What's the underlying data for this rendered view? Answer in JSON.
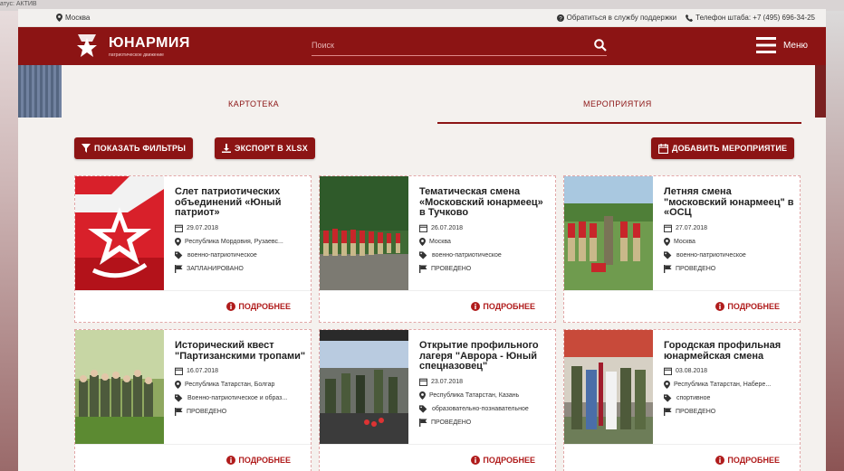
{
  "background": {
    "top_text": "атус: АКТИВ"
  },
  "topbar": {
    "location": "Москва",
    "support": "Обратиться в службу поддержки",
    "phone": "Телефон штаба: +7 (495) 696-34-25"
  },
  "header": {
    "logo_title": "ЮНАРМИЯ",
    "logo_subtitle": "патриотическое движение",
    "search_placeholder": "Поиск",
    "menu_label": "Меню"
  },
  "tabs": [
    {
      "label": "КАРТОТЕКА",
      "active": false
    },
    {
      "label": "МЕРОПРИЯТИЯ",
      "active": true
    }
  ],
  "toolbar": {
    "filters_label": "ПОКАЗАТЬ ФИЛЬТРЫ",
    "export_label": "ЭКСПОРТ В XLSX",
    "add_label": "ДОБАВИТЬ МЕРОПРИЯТИЕ"
  },
  "events": [
    {
      "title": "Слет патриотических объединений «Юный патриот»",
      "date": "29.07.2018",
      "location": "Республика Мордовия, Рузаевс...",
      "category": "военно-патриотическое",
      "status": "ЗАПЛАНИРОВАНО",
      "more": "ПОДРОБНЕЕ"
    },
    {
      "title": "Тематическая смена «Московский юнармеец» в Тучково",
      "date": "26.07.2018",
      "location": "Москва",
      "category": "военно-патриотическое",
      "status": "ПРОВЕДЕНО",
      "more": "ПОДРОБНЕЕ"
    },
    {
      "title": "Летняя смена \"московский юнармеец\" в «ОСЦ",
      "date": "27.07.2018",
      "location": "Москва",
      "category": "военно-патриотическое",
      "status": "ПРОВЕДЕНО",
      "more": "ПОДРОБНЕЕ"
    },
    {
      "title": "Исторический квест \"Партизанскими тропами\"",
      "date": "16.07.2018",
      "location": "Республика Татарстан, Болгар",
      "category": "Военно-патриотическое и образ...",
      "status": "ПРОВЕДЕНО",
      "more": "ПОДРОБНЕЕ"
    },
    {
      "title": "Открытие профильного лагеря \"Аврора - Юный спецназовец\"",
      "date": "23.07.2018",
      "location": "Республика Татарстан, Казань",
      "category": "образовательно-познавательное",
      "status": "ПРОВЕДЕНО",
      "more": "ПОДРОБНЕЕ"
    },
    {
      "title": "Городская профильная юнармейская смена",
      "date": "03.08.2018",
      "location": "Республика Татарстан, Набере...",
      "category": "спортивное",
      "status": "ПРОВЕДЕНО",
      "more": "ПОДРОБНЕЕ"
    }
  ],
  "colors": {
    "brand": "#8c1414",
    "accent_link": "#b01c1c",
    "page_bg": "#f4f1ee"
  }
}
